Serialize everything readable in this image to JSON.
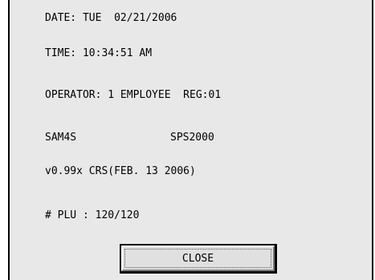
{
  "info": {
    "date_line": "DATE: TUE  02/21/2006",
    "time_line": "TIME: 10:34:51 AM",
    "operator_line": "OPERATOR: 1 EMPLOYEE  REG:01",
    "brand": "SAM4S",
    "model": "SPS2000",
    "version_line": "v0.99x CRS(FEB. 13 2006)",
    "plu_line": "# PLU : 120/120"
  },
  "buttons": {
    "close_label": "CLOSE"
  }
}
